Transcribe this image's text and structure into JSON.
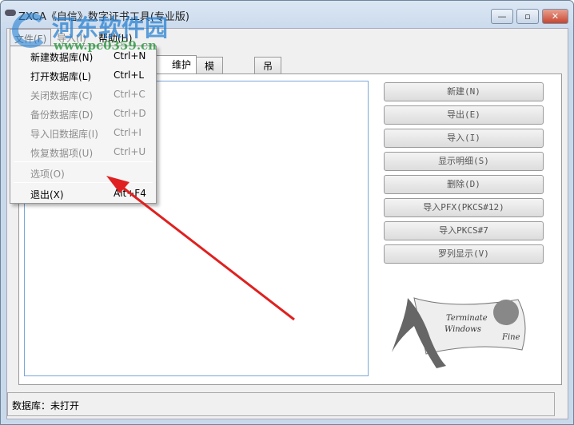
{
  "window": {
    "title": "ZXCA《自信》数字证书工具(专业版)",
    "controls": {
      "minimize": "—",
      "maximize": "▫",
      "close": "✕"
    }
  },
  "menubar": {
    "file": "文件(F)",
    "import": "导入(I)",
    "help": "帮助(H)"
  },
  "file_menu": [
    {
      "label": "新建数据库(N)",
      "shortcut": "Ctrl+N"
    },
    {
      "label": "打开数据库(L)",
      "shortcut": "Ctrl+L"
    },
    {
      "label": "关闭数据库(C)",
      "shortcut": "Ctrl+C"
    },
    {
      "label": "备份数据库(D)",
      "shortcut": "Ctrl+D"
    },
    {
      "label": "导入旧数据库(I)",
      "shortcut": "Ctrl+I"
    },
    {
      "label": "恢复数据项(U)",
      "shortcut": "Ctrl+U"
    },
    {
      "label": "选项(O)",
      "shortcut": ""
    },
    {
      "label": "退出(X)",
      "shortcut": "Alt+F4"
    }
  ],
  "tabs": [
    "维护",
    "模版设置",
    "吊销列表"
  ],
  "buttons": [
    "新建(N)",
    "导出(E)",
    "导入(I)",
    "显示明细(S)",
    "删除(D)",
    "导入PFX(PKCS#12)",
    "导入PKCS#7",
    "罗列显示(V)"
  ],
  "logo_text": [
    "Terminate",
    "Windows",
    "Fine"
  ],
  "status": "数据库：未打开",
  "watermark": {
    "name": "河东软件园",
    "url": "www.pc0359.cn"
  },
  "colors": {
    "arrow": "#e02020",
    "list_border": "#7aa7d8"
  }
}
